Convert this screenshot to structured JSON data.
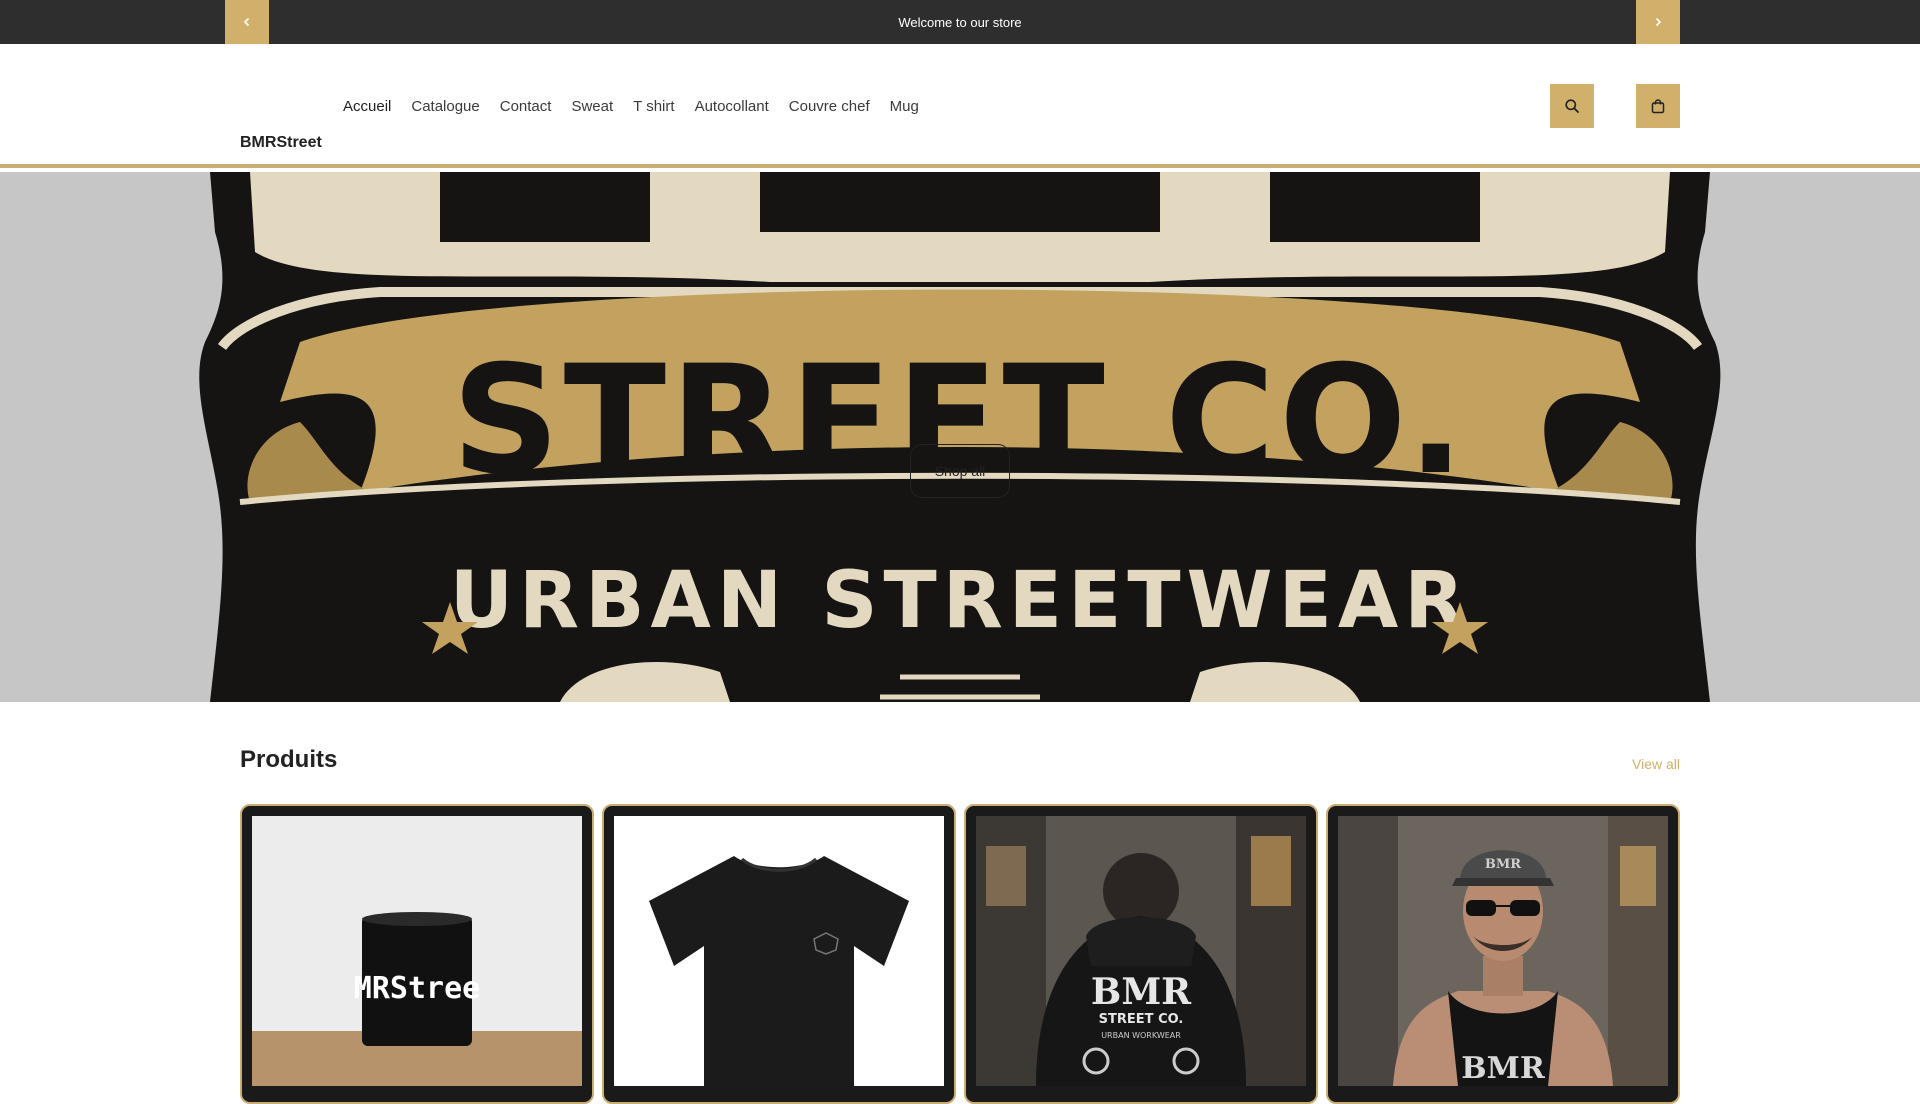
{
  "announcement": {
    "text": "Welcome to our store",
    "prev_icon": "chevron-left-icon",
    "next_icon": "chevron-right-icon"
  },
  "header": {
    "brand": "BMRStreet",
    "nav": [
      "Accueil",
      "Catalogue",
      "Contact",
      "Sweat",
      "T shirt",
      "Autocollant",
      "Couvre chef",
      "Mug"
    ],
    "active_nav": "Accueil",
    "search_icon": "search-icon",
    "cart_icon": "shopping-bag-icon"
  },
  "hero": {
    "logo_line_1": "STREET CO.",
    "logo_line_2": "URBAN STREETWEAR",
    "button_label": "Shop all"
  },
  "products": {
    "title": "Produits",
    "view_all_label": "View all",
    "items": [
      {
        "image": "black mug",
        "mug_text": "MRStree"
      },
      {
        "image": "black t-shirt"
      },
      {
        "image": "man in black hoodie",
        "print": [
          "BMR",
          "STREET CO.",
          "URBAN WORKWEAR"
        ]
      },
      {
        "image": "man in black tank top and cap",
        "print": [
          "BMR"
        ]
      }
    ]
  },
  "colors": {
    "accent": "#d1b06b",
    "topbar": "#2e2e2e",
    "hero_bg": "#c6c6c6"
  }
}
